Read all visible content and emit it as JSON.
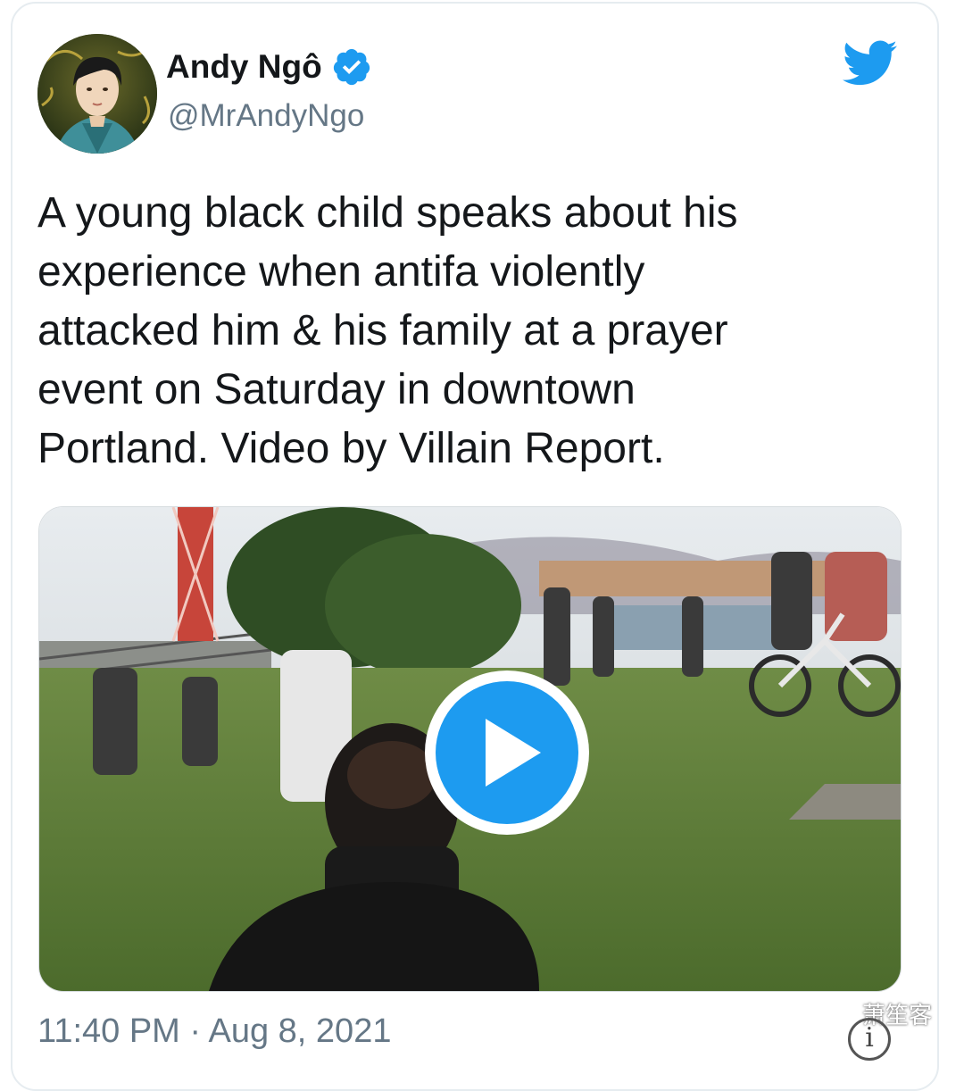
{
  "tweet": {
    "author": {
      "display_name": "Andy Ngô",
      "handle": "@MrAndyNgo",
      "verified": true,
      "avatar_icon": "avatar-illustration"
    },
    "text": "A young black child speaks about his\nexperience when antifa violently\nattacked him & his family at a prayer\nevent on Saturday in downtown\nPortland. Video by Villain Report.",
    "timestamp": "11:40 PM · Aug 8, 2021",
    "media": {
      "type": "video",
      "play_icon": "play-icon"
    }
  },
  "brand": {
    "logo_icon": "twitter-bird-icon",
    "accent_color": "#1d9bf0"
  },
  "watermark": {
    "text": "萧笙客",
    "icon": "wechat-icon"
  },
  "info": {
    "icon": "info-icon",
    "glyph": "i"
  },
  "colors": {
    "text_primary": "#14171a",
    "text_secondary": "#657786",
    "border": "#e6ecf0"
  }
}
